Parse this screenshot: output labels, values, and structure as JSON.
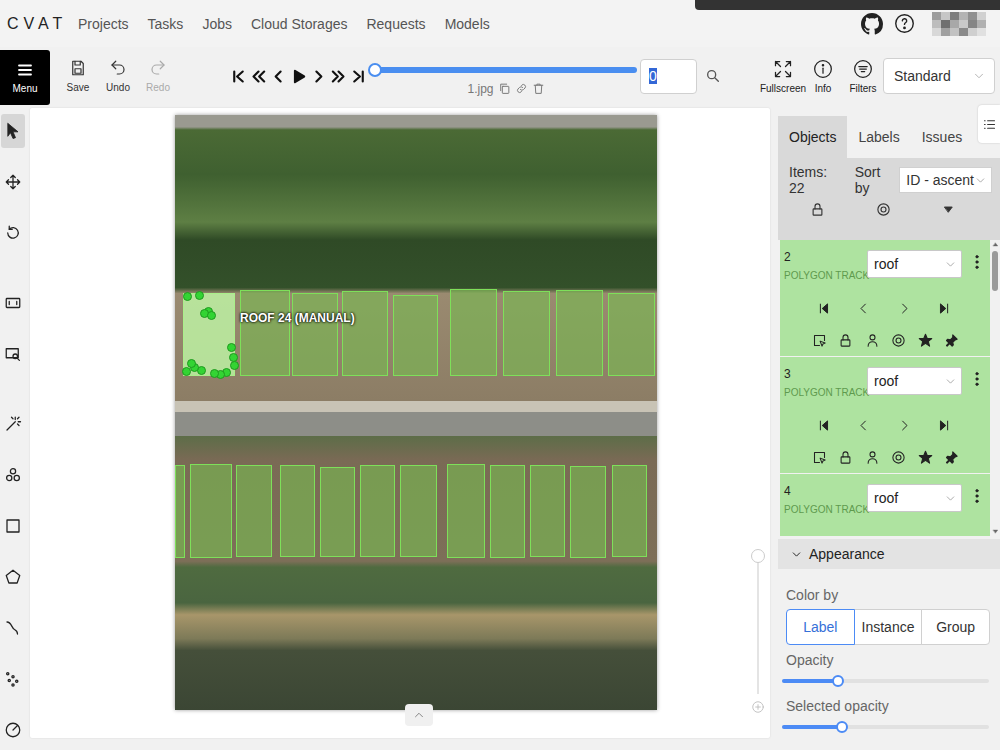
{
  "nav": {
    "logo": "CVAT",
    "items": [
      "Projects",
      "Tasks",
      "Jobs",
      "Cloud Storages",
      "Requests",
      "Models"
    ]
  },
  "toolbar": {
    "menu": "Menu",
    "actions": [
      {
        "label": "Save",
        "disabled": false
      },
      {
        "label": "Undo",
        "disabled": false
      },
      {
        "label": "Redo",
        "disabled": true
      }
    ],
    "player": {
      "level": 0,
      "frame": "0",
      "frame_highlighted": true,
      "filename": "1.jpg"
    },
    "view_buttons": [
      "Fullscreen",
      "Info",
      "Filters"
    ],
    "workspace": "Standard"
  },
  "tools": [
    {
      "selected": true
    },
    {
      "selected": false
    },
    {
      "selected": false
    },
    {
      "selected": false
    },
    {
      "selected": false
    },
    {
      "selected": false
    },
    {
      "selected": false
    },
    {
      "selected": false
    },
    {
      "selected": false
    },
    {
      "selected": false
    },
    {
      "selected": false
    },
    {
      "selected": false
    }
  ],
  "canvas": {
    "object_label": "ROOF 24 (MANUAL)",
    "zoom_level": 1
  },
  "sidebar": {
    "tabs": [
      {
        "label": "Objects",
        "selected": true
      },
      {
        "label": "Labels",
        "selected": false
      },
      {
        "label": "Issues",
        "selected": false
      }
    ],
    "items_count": "Items: 22",
    "sort_label": "Sort by",
    "sort_value": "ID - ascent",
    "objects": [
      {
        "id": "2",
        "type": "POLYGON TRACK",
        "label": "roof"
      },
      {
        "id": "3",
        "type": "POLYGON TRACK",
        "label": "roof"
      },
      {
        "id": "4",
        "type": "POLYGON TRACK",
        "label": "roof"
      }
    ]
  },
  "appearance": {
    "title": "Appearance",
    "expanded": true,
    "color_by_label": "Color by",
    "color_by": [
      {
        "label": "Label",
        "selected": true
      },
      {
        "label": "Instance",
        "selected": false
      },
      {
        "label": "Group",
        "selected": false
      }
    ],
    "sliders": [
      {
        "label": "Opacity",
        "level": 0.27
      },
      {
        "label": "Selected opacity",
        "level": 0.29
      }
    ]
  }
}
